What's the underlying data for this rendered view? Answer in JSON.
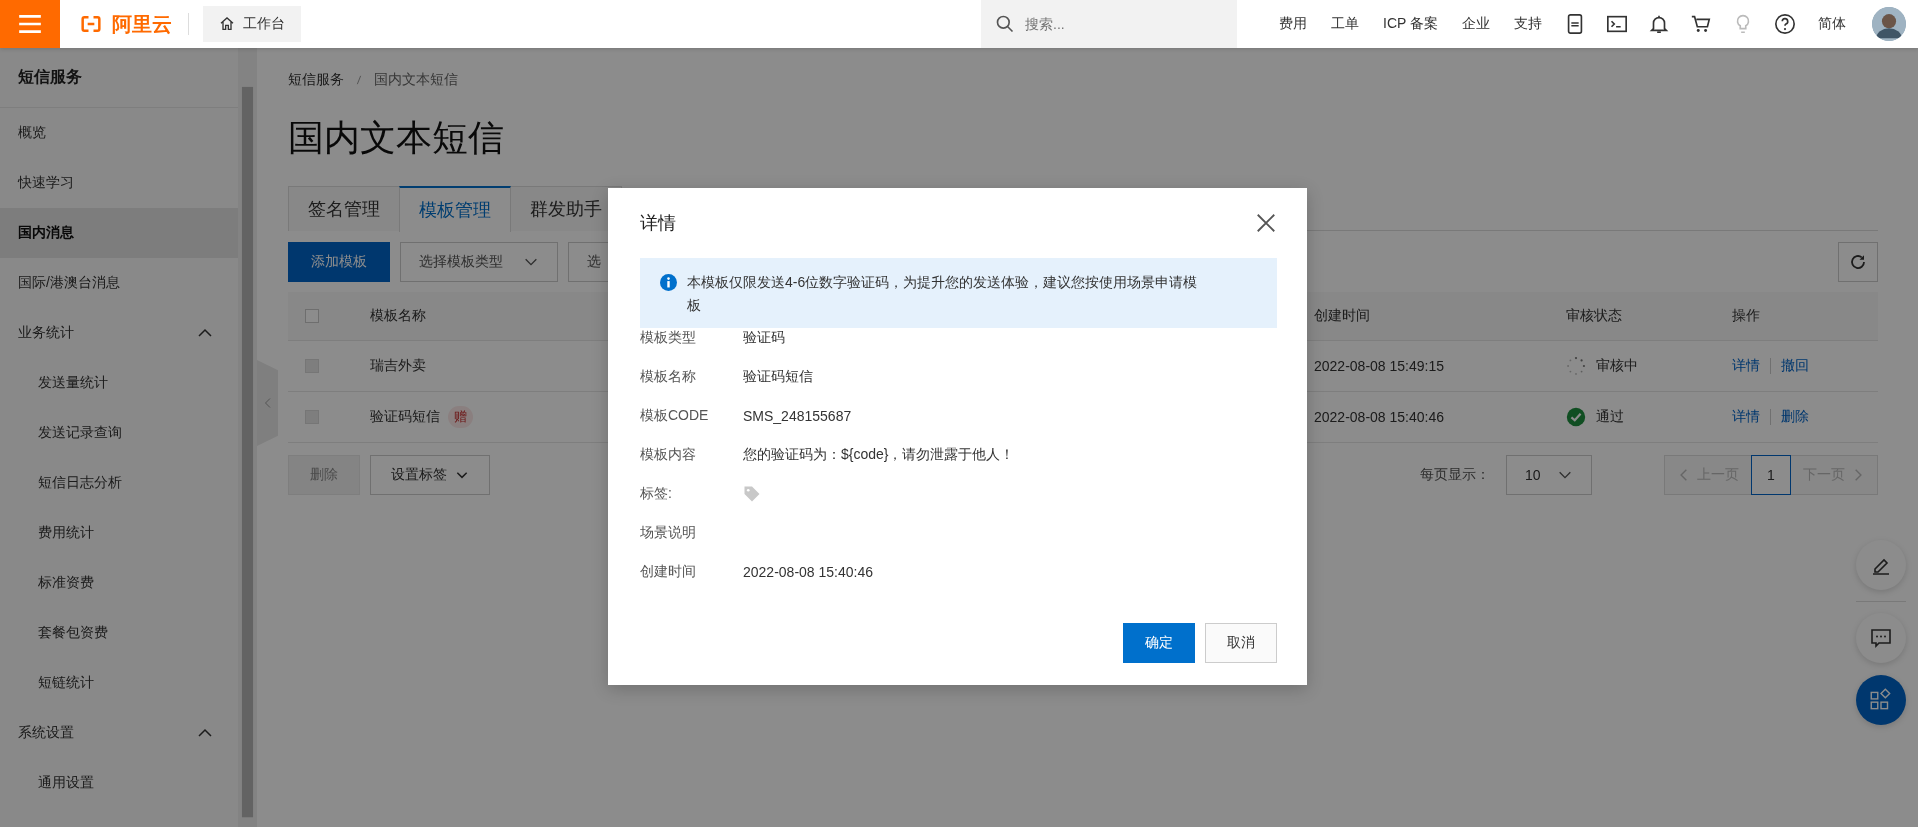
{
  "top_bar": {
    "logo": "阿里云",
    "workbench": "工作台",
    "search": {
      "placeholder": "搜索..."
    },
    "links": [
      "费用",
      "工单",
      "ICP 备案",
      "企业",
      "支持"
    ],
    "language": "简体"
  },
  "sidebar": {
    "title": "短信服务",
    "items": [
      {
        "label": "概览",
        "selected": false
      },
      {
        "label": "快速学习",
        "selected": false
      },
      {
        "label": "国内消息",
        "selected": true
      },
      {
        "label": "国际/港澳台消息",
        "selected": false
      },
      {
        "label": "业务统计",
        "expanded": true,
        "children": [
          {
            "label": "发送量统计",
            "selected": false
          },
          {
            "label": "发送记录查询",
            "selected": false
          },
          {
            "label": "短信日志分析",
            "selected": false
          },
          {
            "label": "费用统计",
            "selected": false
          },
          {
            "label": "标准资费",
            "selected": false
          },
          {
            "label": "套餐包资费",
            "selected": false
          },
          {
            "label": "短链统计",
            "selected": false
          }
        ]
      },
      {
        "label": "系统设置",
        "expanded": true,
        "children": [
          {
            "label": "通用设置",
            "selected": false
          }
        ]
      }
    ]
  },
  "breadcrumb": [
    "短信服务",
    "国内文本短信"
  ],
  "page_title": "国内文本短信",
  "tabs": [
    {
      "label": "签名管理",
      "selected": false
    },
    {
      "label": "模板管理",
      "selected": true
    },
    {
      "label": "群发助手",
      "selected": false
    }
  ],
  "toolbar": {
    "add_button": "添加模板",
    "filters": [
      "选择模板类型",
      "选"
    ]
  },
  "table": {
    "header_checkbox": {
      "checked": false,
      "disabled": false
    },
    "columns": [
      "模板名称",
      "创建时间",
      "审核状态",
      "操作"
    ],
    "rows": [
      {
        "checked": false,
        "disabled": true,
        "name": "瑞吉外卖",
        "created": "2022-08-08 15:49:15",
        "status": {
          "kind": "pending",
          "label": "审核中"
        },
        "actions": [
          "详情",
          "撤回"
        ]
      },
      {
        "checked": false,
        "disabled": true,
        "name": "验证码短信",
        "badge": "赠",
        "created": "2022-08-08 15:40:46",
        "status": {
          "kind": "approved",
          "label": "通过"
        },
        "actions": [
          "详情",
          "删除"
        ]
      }
    ]
  },
  "footer": {
    "delete_button": {
      "label": "删除",
      "disabled": true
    },
    "tag_button": "设置标签",
    "page_size_label": "每页显示：",
    "page_size": "10",
    "pagination": {
      "prev": "上一页",
      "pages": [
        {
          "label": "1",
          "selected": true
        }
      ],
      "next": "下一页"
    }
  },
  "modal": {
    "title": "详情",
    "alert": "本模板仅限发送4-6位数字验证码，为提升您的发送体验，建议您按使用场景申请模板",
    "fields": [
      {
        "kind": "text",
        "label": "模板类型",
        "value": "验证码"
      },
      {
        "kind": "text",
        "label": "模板名称",
        "value": "验证码短信"
      },
      {
        "kind": "text",
        "label": "模板CODE",
        "value": "SMS_248155687"
      },
      {
        "kind": "text",
        "label": "模板内容",
        "value": "您的验证码为：${code}，请勿泄露于他人！"
      },
      {
        "kind": "tag",
        "label": "标签:"
      },
      {
        "kind": "text",
        "label": "场景说明"
      },
      {
        "kind": "text",
        "label": "创建时间",
        "value": "2022-08-08 15:40:46"
      }
    ],
    "buttons": [
      {
        "kind": "primary",
        "label": "确定"
      },
      {
        "kind": "default",
        "label": "取消"
      }
    ]
  }
}
